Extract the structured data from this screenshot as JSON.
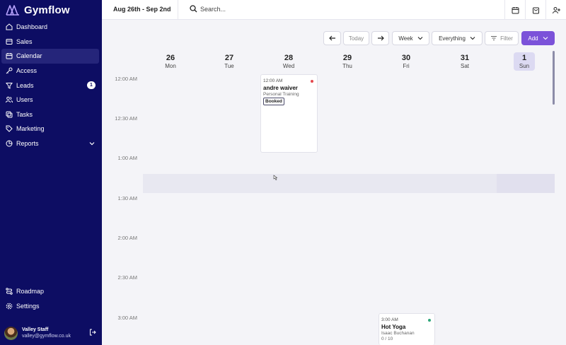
{
  "app": {
    "name": "Gymflow"
  },
  "sidebar": {
    "items": [
      {
        "label": "Dashboard",
        "icon": "home-icon"
      },
      {
        "label": "Sales",
        "icon": "sales-icon"
      },
      {
        "label": "Calendar",
        "icon": "calendar-icon",
        "active": true
      },
      {
        "label": "Access",
        "icon": "key-icon"
      },
      {
        "label": "Leads",
        "icon": "filter-icon",
        "badge": "1"
      },
      {
        "label": "Users",
        "icon": "users-icon"
      },
      {
        "label": "Tasks",
        "icon": "tasks-icon"
      },
      {
        "label": "Marketing",
        "icon": "tag-icon"
      },
      {
        "label": "Reports",
        "icon": "chart-pie-icon",
        "expandable": true
      }
    ],
    "bottom_items": [
      {
        "label": "Roadmap",
        "icon": "roadmap-icon"
      },
      {
        "label": "Settings",
        "icon": "gear-icon"
      }
    ],
    "user": {
      "name": "Valley Staff",
      "email": "valley@gymflow.co.uk"
    }
  },
  "topbar": {
    "date_range": "Aug 26th - Sep 2nd",
    "search_placeholder": "Search..."
  },
  "toolbar": {
    "today_label": "Today",
    "view_label": "Week",
    "scope_label": "Everything",
    "filter_label": "Filter",
    "add_label": "Add"
  },
  "days": [
    {
      "num": "26",
      "name": "Mon"
    },
    {
      "num": "27",
      "name": "Tue"
    },
    {
      "num": "28",
      "name": "Wed"
    },
    {
      "num": "29",
      "name": "Thu"
    },
    {
      "num": "30",
      "name": "Fri"
    },
    {
      "num": "31",
      "name": "Sat"
    },
    {
      "num": "1",
      "name": "Sun",
      "today": true
    }
  ],
  "times": [
    "12:00 AM",
    "12:30 AM",
    "1:00 AM",
    "1:30 AM",
    "2:00 AM",
    "2:30 AM",
    "3:00 AM"
  ],
  "events": [
    {
      "time": "12:00 AM",
      "title": "andre waiver",
      "subtitle": "Personal Training",
      "status": "Booked",
      "dot_color": "#e5484d"
    },
    {
      "time": "3:00 AM",
      "title": "Hot Yoga",
      "subtitle": "Isaac Buchanan",
      "capacity": "0 / 10",
      "dot_color": "#2fa67a"
    }
  ],
  "colors": {
    "sidebar": "#0d0d63",
    "accent": "#7b52d9",
    "today_bg": "#dcdaf2"
  }
}
